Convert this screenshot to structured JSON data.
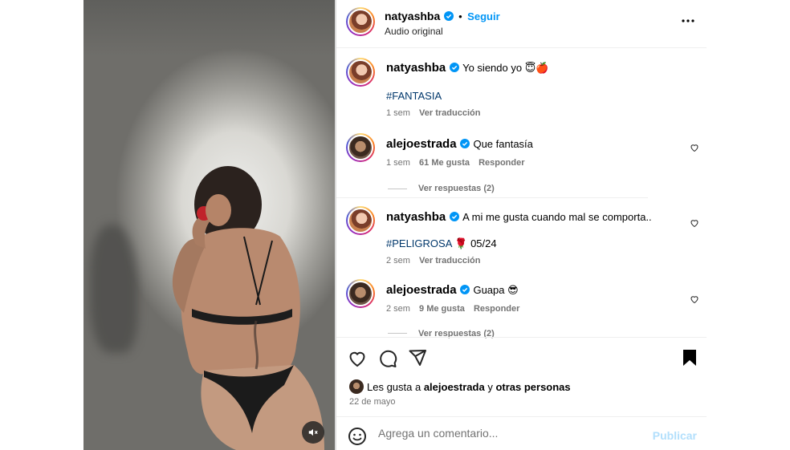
{
  "header": {
    "username": "natyashba",
    "separator": "•",
    "follow_label": "Seguir",
    "subtitle": "Audio original",
    "more_icon": "more-horizontal-icon"
  },
  "caption": {
    "username": "natyashba",
    "text": "Yo siendo yo 😇🍎",
    "hashtag": "#FANTASIA",
    "time": "1 sem",
    "translate": "Ver traducción"
  },
  "comments": [
    {
      "username": "alejoestrada",
      "text": "Que fantasía",
      "time": "1 sem",
      "likes": "61 Me gusta",
      "reply": "Responder",
      "view_replies": "Ver respuestas (2)"
    },
    {
      "username": "natyashba",
      "text": "A mi me gusta cuando mal se comporta..",
      "line2_tag": "#PELIGROSA",
      "line2_rest": " 🌹 05/24",
      "time": "2 sem",
      "translate": "Ver traducción"
    },
    {
      "username": "alejoestrada",
      "text": "Guapa 😎",
      "time": "2 sem",
      "likes": "9 Me gusta",
      "reply": "Responder",
      "view_replies": "Ver respuestas (2)"
    }
  ],
  "likes_line": {
    "prefix": "Les gusta a ",
    "user": "alejoestrada",
    "joiner": " y ",
    "others": "otras personas"
  },
  "date": "22 de mayo",
  "add_comment": {
    "placeholder": "Agrega un comentario...",
    "publish": "Publicar"
  },
  "colors": {
    "accent": "#0095f6",
    "hashtag": "#00376b",
    "muted": "#737373",
    "publish_disabled": "#b2dffc"
  }
}
